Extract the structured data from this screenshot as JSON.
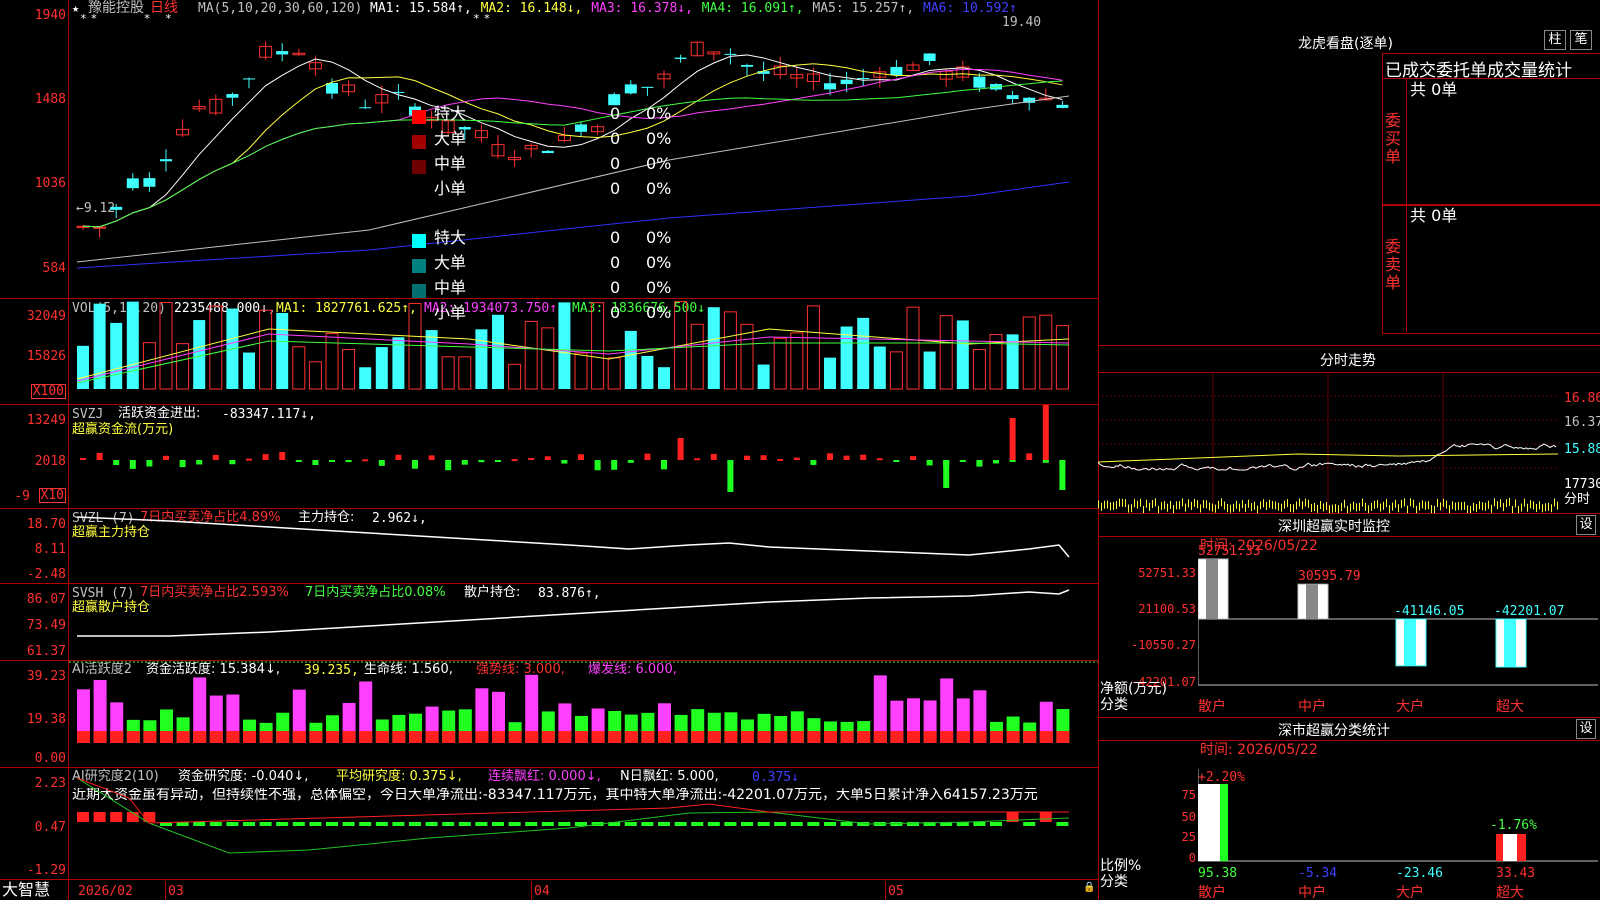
{
  "stock": {
    "name": "豫能控股",
    "period": "日线",
    "star": "★",
    "mark": "*"
  },
  "main": {
    "ma_label": "MA(5,10,20,30,60,120)",
    "ma": [
      {
        "label": "MA1:",
        "value": "15.584",
        "dir": "↑",
        "color": "#ffffff"
      },
      {
        "label": "MA2:",
        "value": "16.148",
        "dir": "↓",
        "color": "#ffff40"
      },
      {
        "label": "MA3:",
        "value": "16.378",
        "dir": "↓",
        "color": "#ff40ff"
      },
      {
        "label": "MA4:",
        "value": "16.091",
        "dir": "↑",
        "color": "#40ff40"
      },
      {
        "label": "MA5:",
        "value": "15.257",
        "dir": "↑",
        "color": "#c0c0c0"
      },
      {
        "label": "MA6:",
        "value": "10.592",
        "dir": "↑",
        "color": "#4040ff"
      }
    ],
    "axis": [
      "1940",
      "1488",
      "1036",
      "584"
    ],
    "high_label": "19.40",
    "low_label": "←9.12"
  },
  "vol": {
    "title": "VOL(5,10,20)",
    "value": "2235488.000↓,",
    "ma1": "MA1: 1827761.625↑,",
    "ma2": "MA2: 1934073.750↑,",
    "ma3": "MA3: 1836676.500↓",
    "axis": [
      "32049",
      "15826"
    ],
    "unit": "X100"
  },
  "svzj": {
    "title": "SVZJ",
    "label": "活跃资金进出:",
    "value": "-83347.117↓,",
    "sub": "超赢资金流(万元)",
    "axis": [
      "13249",
      "2018",
      "-9"
    ],
    "unit": "X10"
  },
  "svzl": {
    "title": "SVZL (7)",
    "t1": "7日内买卖净占比4.89%",
    "t2": "主力持仓:",
    "value": "2.962↓,",
    "sub": "超赢主力持仓",
    "axis": [
      "18.70",
      "8.11",
      "-2.48"
    ]
  },
  "svsh": {
    "title": "SVSH (7)",
    "t1": "7日内买卖净占比2.593%",
    "t2": "7日内买卖净占比0.08%",
    "t3": "散户持仓:",
    "value": "83.876↑,",
    "sub": "超赢散户持仓",
    "axis": [
      "86.07",
      "73.49",
      "61.37"
    ]
  },
  "ai1": {
    "title": "AI活跃度2",
    "t1": "资金活跃度: 15.384↓,",
    "t2": "39.235,",
    "t3": "生命线: 1.560,",
    "t4": "强势线: 3.000,",
    "t5": "爆发线: 6.000,",
    "axis": [
      "39.23",
      "19.38",
      "0.00"
    ]
  },
  "ai2": {
    "title": "AI研究度2(10)",
    "t1": "资金研究度: -0.040↓,",
    "t2": "平均研究度: 0.375↓,",
    "t3": "连续飘红: 0.000↓,",
    "t4": "N日飘红: 5.000,",
    "t5": "0.375↓",
    "axis": [
      "2.23",
      "0.47",
      "-1.29"
    ],
    "comment": "近期大资金虽有异动，但持续性不强，总体偏空，今日大单净流出:-83347.117万元，其中特大单净流出:-42201.07万元，大单5日累计净入64157.23万元"
  },
  "bottom": {
    "logo": "大智慧",
    "dates": [
      "2026/02",
      "03",
      "04",
      "05"
    ]
  },
  "lhb": {
    "title": "龙虎看盘(逐单)",
    "btn1": "柱",
    "btn2": "笔",
    "tabs": "已成交委托单成交量统计",
    "buy": {
      "side": "委买单",
      "total": "共 0单",
      "rows": [
        {
          "name": "特大",
          "n": "0",
          "p": "0%",
          "color": "#ff0000"
        },
        {
          "name": "大单",
          "n": "0",
          "p": "0%",
          "color": "#a00000"
        },
        {
          "name": "中单",
          "n": "0",
          "p": "0%",
          "color": "#700000"
        },
        {
          "name": "小单",
          "n": "0",
          "p": "0%",
          "color": ""
        }
      ]
    },
    "sell": {
      "side": "委卖单",
      "total": "共 0单",
      "rows": [
        {
          "name": "特大",
          "n": "0",
          "p": "0%",
          "color": "#00ffff"
        },
        {
          "name": "大单",
          "n": "0",
          "p": "0%",
          "color": "#008080"
        },
        {
          "name": "中单",
          "n": "0",
          "p": "0%",
          "color": "#007070"
        },
        {
          "name": "小单",
          "n": "0",
          "p": "0%",
          "color": ""
        }
      ]
    }
  },
  "fenshi": {
    "title": "分时走势",
    "axis": [
      "16.86",
      "16.37",
      "15.88",
      "17730",
      "分时"
    ]
  },
  "monitor": {
    "title": "深圳超赢实时监控",
    "btn": "设",
    "time": "时间: 2026/05/22",
    "axis": [
      "52751.33",
      "21100.53",
      "-10550.27",
      "-42201.07"
    ],
    "unit1": "净额(万元)",
    "unit2": "分类",
    "cats": [
      "散户",
      "中户",
      "大户",
      "超大"
    ],
    "values": [
      "52751.33",
      "30595.79",
      "-41146.05",
      "-42201.07"
    ]
  },
  "stats": {
    "title": "深市超赢分类统计",
    "btn": "设",
    "time": "时间: 2026/05/22",
    "axis": [
      "75",
      "50",
      "25",
      "0"
    ],
    "unit1": "比例%",
    "unit2": "分类",
    "top": [
      "+2.20%",
      "-1.76%"
    ],
    "cats": [
      "散户",
      "中户",
      "大户",
      "超大"
    ],
    "values": [
      "95.38",
      "-5.34",
      "-23.46",
      "33.43"
    ]
  }
}
